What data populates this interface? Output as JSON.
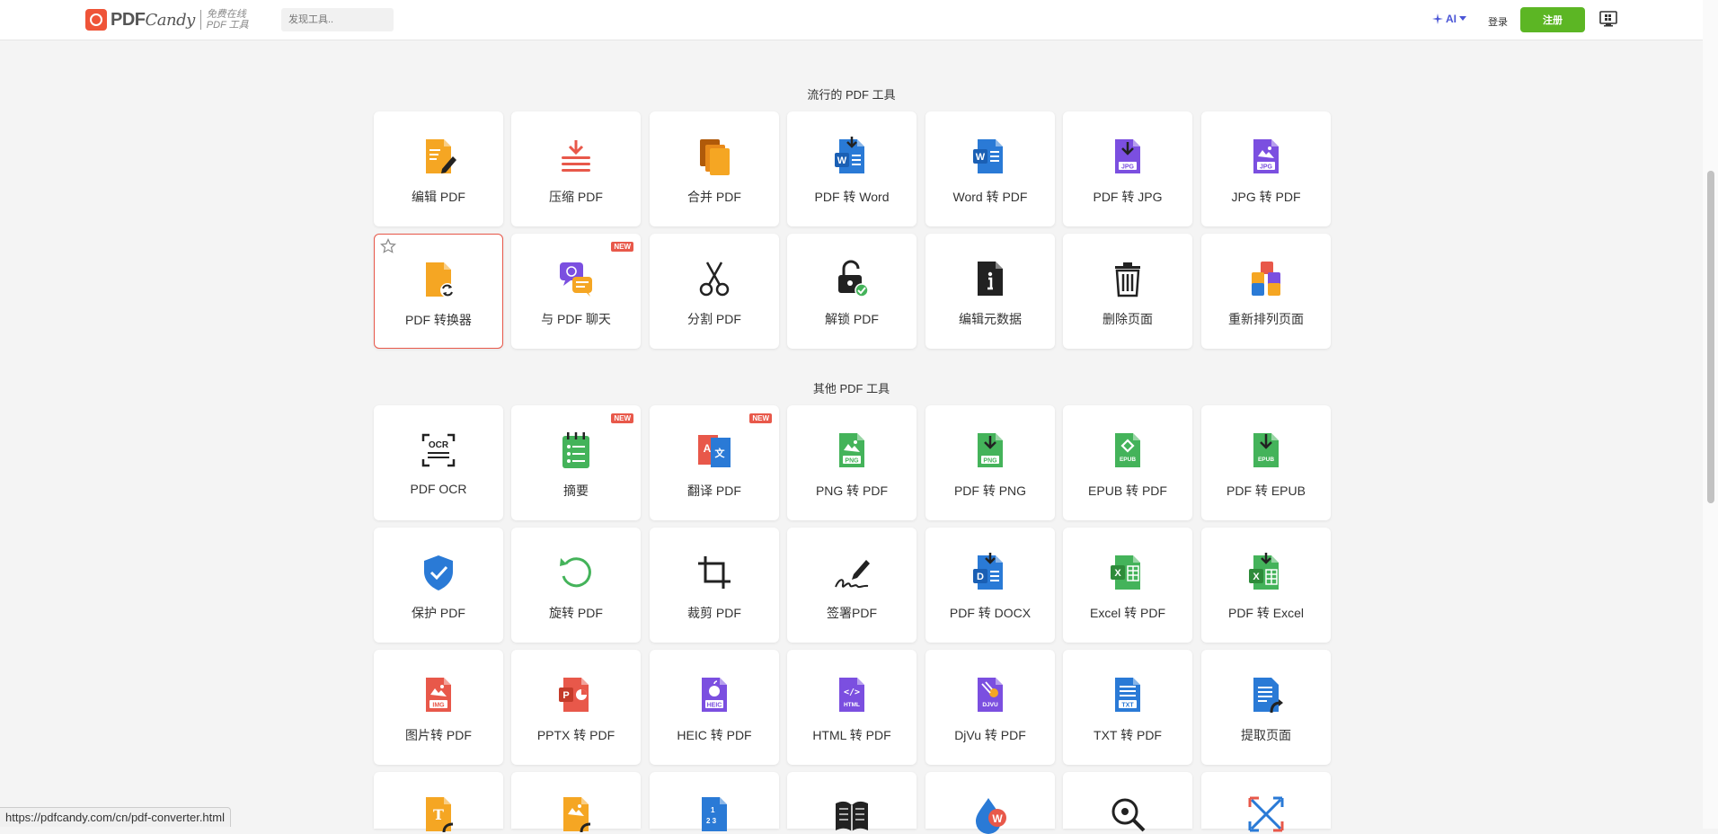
{
  "header": {
    "logo_text": "PDF",
    "logo_italic": "Candy",
    "logo_sub_line1": "免费在线",
    "logo_sub_line2": "PDF 工具",
    "search_placeholder": "发现工具..",
    "ai_label": "AI",
    "login_label": "登录",
    "register_label": "注册"
  },
  "sections": {
    "popular_title": "流行的 PDF 工具",
    "other_title": "其他 PDF 工具"
  },
  "badge_new": "NEW",
  "popular_tools": [
    {
      "label": "编辑 PDF",
      "icon": "edit-pdf-icon"
    },
    {
      "label": "压缩 PDF",
      "icon": "compress-pdf-icon"
    },
    {
      "label": "合并 PDF",
      "icon": "merge-pdf-icon"
    },
    {
      "label": "PDF 转 Word",
      "icon": "pdf-to-word-icon"
    },
    {
      "label": "Word 转 PDF",
      "icon": "word-to-pdf-icon"
    },
    {
      "label": "PDF 转 JPG",
      "icon": "pdf-to-jpg-icon"
    },
    {
      "label": "JPG 转 PDF",
      "icon": "jpg-to-pdf-icon"
    },
    {
      "label": "PDF 转换器",
      "icon": "pdf-converter-icon"
    },
    {
      "label": "与 PDF 聊天",
      "icon": "chat-pdf-icon"
    },
    {
      "label": "分割 PDF",
      "icon": "scissors-icon"
    },
    {
      "label": "解锁 PDF",
      "icon": "unlock-icon"
    },
    {
      "label": "编辑元数据",
      "icon": "metadata-icon"
    },
    {
      "label": "删除页面",
      "icon": "trash-icon"
    },
    {
      "label": "重新排列页面",
      "icon": "rearrange-icon"
    }
  ],
  "other_tools": [
    {
      "label": "PDF OCR",
      "icon": "ocr-icon"
    },
    {
      "label": "摘要",
      "icon": "summary-icon"
    },
    {
      "label": "翻译 PDF",
      "icon": "translate-icon"
    },
    {
      "label": "PNG 转 PDF",
      "icon": "png-to-pdf-icon"
    },
    {
      "label": "PDF 转 PNG",
      "icon": "pdf-to-png-icon"
    },
    {
      "label": "EPUB 转 PDF",
      "icon": "epub-to-pdf-icon"
    },
    {
      "label": "PDF 转 EPUB",
      "icon": "pdf-to-epub-icon"
    },
    {
      "label": "保护 PDF",
      "icon": "shield-icon"
    },
    {
      "label": "旋转 PDF",
      "icon": "rotate-icon"
    },
    {
      "label": "裁剪 PDF",
      "icon": "crop-icon"
    },
    {
      "label": "签署PDF",
      "icon": "signature-icon"
    },
    {
      "label": "PDF 转 DOCX",
      "icon": "pdf-to-docx-icon"
    },
    {
      "label": "Excel 转 PDF",
      "icon": "excel-to-pdf-icon"
    },
    {
      "label": "PDF 转 Excel",
      "icon": "pdf-to-excel-icon"
    },
    {
      "label": "图片转 PDF",
      "icon": "image-to-pdf-icon"
    },
    {
      "label": "PPTX 转 PDF",
      "icon": "pptx-to-pdf-icon"
    },
    {
      "label": "HEIC 转 PDF",
      "icon": "heic-to-pdf-icon"
    },
    {
      "label": "HTML 转 PDF",
      "icon": "html-to-pdf-icon"
    },
    {
      "label": "DjVu 转 PDF",
      "icon": "djvu-to-pdf-icon"
    },
    {
      "label": "TXT 转 PDF",
      "icon": "txt-to-pdf-icon"
    },
    {
      "label": "提取页面",
      "icon": "extract-pages-icon"
    }
  ],
  "status_url": "https://pdfcandy.com/cn/pdf-converter.html",
  "colors": {
    "accent_red": "#e8584a",
    "register_green": "#5cb624",
    "ai_blue": "#4a55d6"
  }
}
